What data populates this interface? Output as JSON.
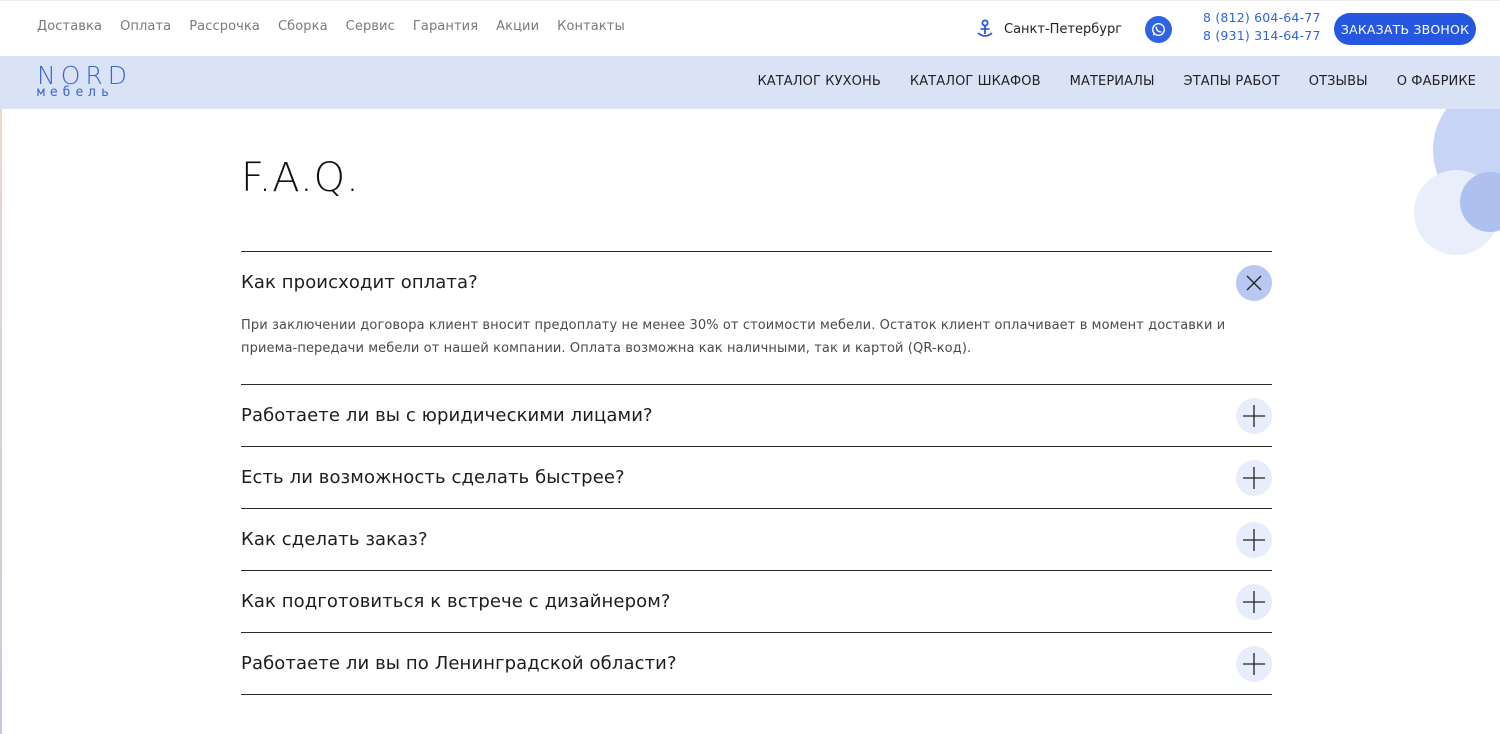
{
  "topbar": {
    "nav": [
      "Доставка",
      "Оплата",
      "Рассрочка",
      "Сборка",
      "Сервис",
      "Гарантия",
      "Акции",
      "Контакты"
    ],
    "city": "Санкт-Петербург",
    "phones": [
      "8 (812) 604-64-77",
      "8 (931) 314-64-77"
    ],
    "call_button": "ЗАКАЗАТЬ ЗВОНОК"
  },
  "logo": {
    "main": "NORD",
    "sub": "мебель"
  },
  "mainnav": [
    "КАТАЛОГ КУХОНЬ",
    "КАТАЛОГ ШКАФОВ",
    "МАТЕРИАЛЫ",
    "ЭТАПЫ РАБОТ",
    "ОТЗЫВЫ",
    "О ФАБРИКЕ"
  ],
  "faq": {
    "title": "F.A.Q.",
    "items": [
      {
        "question": "Как происходит оплата?",
        "answer": "При заключении договора клиент вносит предоплату не менее 30% от стоимости мебели. Остаток клиент оплачивает в момент доставки и приема-передачи мебели от нашей компании. Оплата возможна как наличными, так и картой (QR-код).",
        "open": true
      },
      {
        "question": "Работаете ли вы с юридическими лицами?",
        "open": false
      },
      {
        "question": "Есть ли возможность сделать быстрее?",
        "open": false
      },
      {
        "question": "Как сделать заказ?",
        "open": false
      },
      {
        "question": "Как подготовиться к встрече с дизайнером?",
        "open": false
      },
      {
        "question": "Работаете ли вы по Ленинградской области?",
        "open": false
      }
    ]
  },
  "colors": {
    "accent": "#2657e0",
    "navbar_bg": "#dae3f5",
    "open_toggle_bg": "#b9c8f2",
    "closed_toggle_bg": "#e8edfb"
  }
}
